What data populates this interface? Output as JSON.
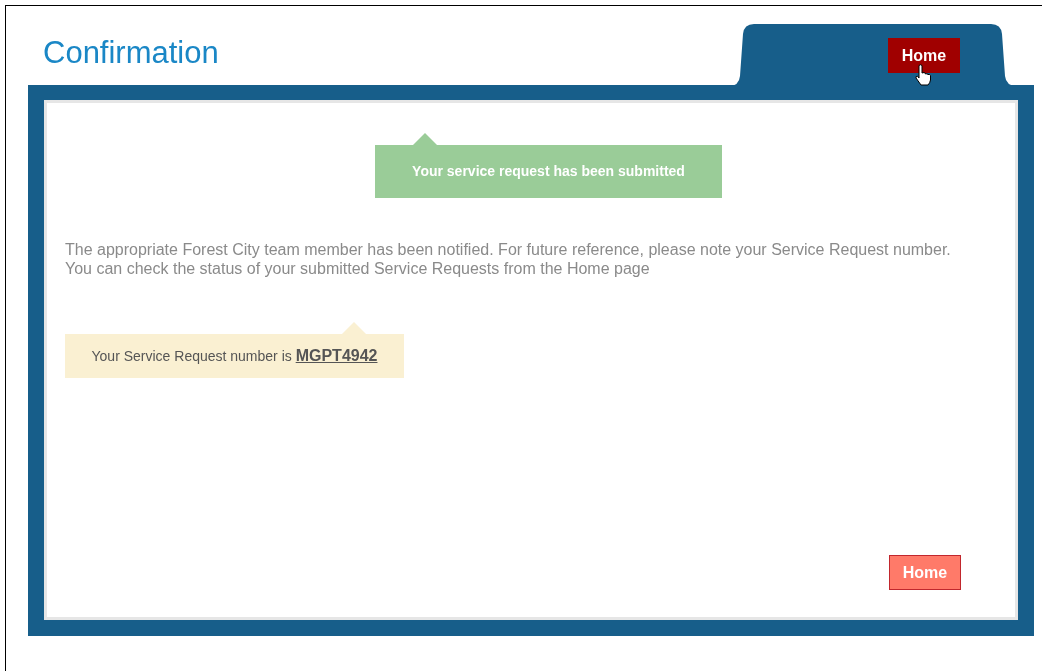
{
  "title": "Confirmation",
  "tab_button": {
    "label": "Home",
    "hovered": true
  },
  "notice": "Your service request has been submitted",
  "message_lines": [
    "The appropriate Forest City team member has been notified. For future reference, please note your Service Request number.",
    "You can check the status of your submitted Service Requests from the Home page"
  ],
  "request_number": {
    "label": "Your Service Request number is",
    "number": "MGPT4942"
  },
  "footer_button": {
    "label": "Home",
    "hovered": false
  }
}
